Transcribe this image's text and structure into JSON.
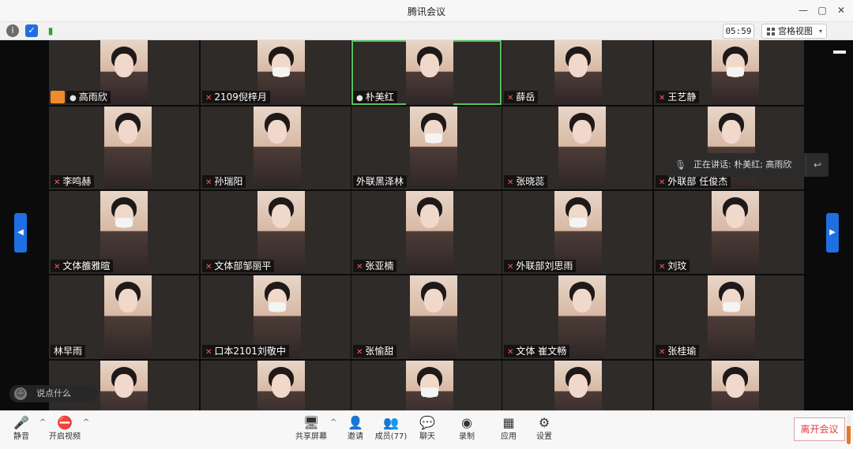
{
  "window": {
    "title": "腾讯会议",
    "controls": [
      "—",
      "▢",
      "✕"
    ]
  },
  "top_toolbar": {
    "time": "05:59",
    "view_label": "宫格视图",
    "view_caret": "▾"
  },
  "speaking": {
    "text": "正在讲话: 朴美红; 高雨欣",
    "back_icon": "reply-icon"
  },
  "chat_input": {
    "placeholder": "说点什么"
  },
  "participants": [
    {
      "name": "高雨欣",
      "mic": "on",
      "host": true
    },
    {
      "name": "2109倪梓月",
      "mic": "muted"
    },
    {
      "name": "朴美红",
      "mic": "on",
      "active": true
    },
    {
      "name": "薛岳",
      "mic": "muted"
    },
    {
      "name": "王艺静",
      "mic": "muted"
    },
    {
      "name": "李鸣赫",
      "mic": "muted"
    },
    {
      "name": "孙瑞阳",
      "mic": "muted"
    },
    {
      "name": "外联黑泽林",
      "mic": "none"
    },
    {
      "name": "张晓蕊",
      "mic": "muted"
    },
    {
      "name": "外联部 任俊杰",
      "mic": "muted"
    },
    {
      "name": "文体雒雅暄",
      "mic": "muted"
    },
    {
      "name": "文体部邹丽平",
      "mic": "muted"
    },
    {
      "name": "张亚楠",
      "mic": "muted"
    },
    {
      "name": "外联部刘思雨",
      "mic": "muted"
    },
    {
      "name": "刘玟",
      "mic": "muted"
    },
    {
      "name": "林早雨",
      "mic": "none"
    },
    {
      "name": "口本2101刘敬中",
      "mic": "muted"
    },
    {
      "name": "张愉甜",
      "mic": "muted"
    },
    {
      "name": "文体  崔文畅",
      "mic": "muted"
    },
    {
      "name": "张桂瑜",
      "mic": "muted"
    },
    {
      "name": "",
      "mic": "none"
    },
    {
      "name": "",
      "mic": "none"
    },
    {
      "name": "",
      "mic": "none"
    },
    {
      "name": "",
      "mic": "none"
    },
    {
      "name": "",
      "mic": "none"
    }
  ],
  "bottom": {
    "mute": "静音",
    "video": "开启视频",
    "share": "共享屏幕",
    "invite": "邀请",
    "members": "成员(77)",
    "chat": "聊天",
    "record": "录制",
    "apps": "应用",
    "settings": "设置",
    "leave": "离开会议"
  },
  "colors": {
    "accent_blue": "#1f6fe3",
    "leave_red": "#e53b3b",
    "active_green": "#57c35a"
  }
}
